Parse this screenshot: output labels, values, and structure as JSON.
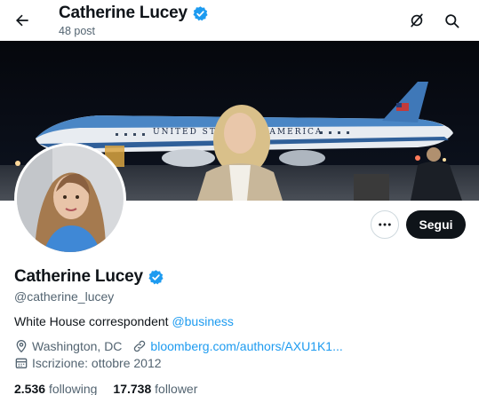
{
  "header": {
    "name": "Catherine Lucey",
    "post_count": "48 post"
  },
  "profile": {
    "display_name": "Catherine Lucey",
    "handle": "@catherine_lucey",
    "bio_text": "White House correspondent ",
    "bio_mention": "@business",
    "location": "Washington, DC",
    "website": "bloomberg.com/authors/AXU1K1...",
    "joined": "Iscrizione: ottobre 2012",
    "following_count": "2.536",
    "following_label": "following",
    "followers_count": "17.738",
    "followers_label": "follower"
  },
  "actions": {
    "follow_label": "Segui"
  },
  "banner": {
    "plane_text": "UNITED STATES OF AMERICA"
  },
  "colors": {
    "accent": "#1d9bf0",
    "text": "#0f1419",
    "muted": "#536471",
    "follow_bg": "#0f1419"
  },
  "icons": [
    "back-arrow-icon",
    "verified-badge-icon",
    "grok-icon",
    "search-icon",
    "more-icon",
    "location-icon",
    "link-icon",
    "calendar-icon"
  ]
}
